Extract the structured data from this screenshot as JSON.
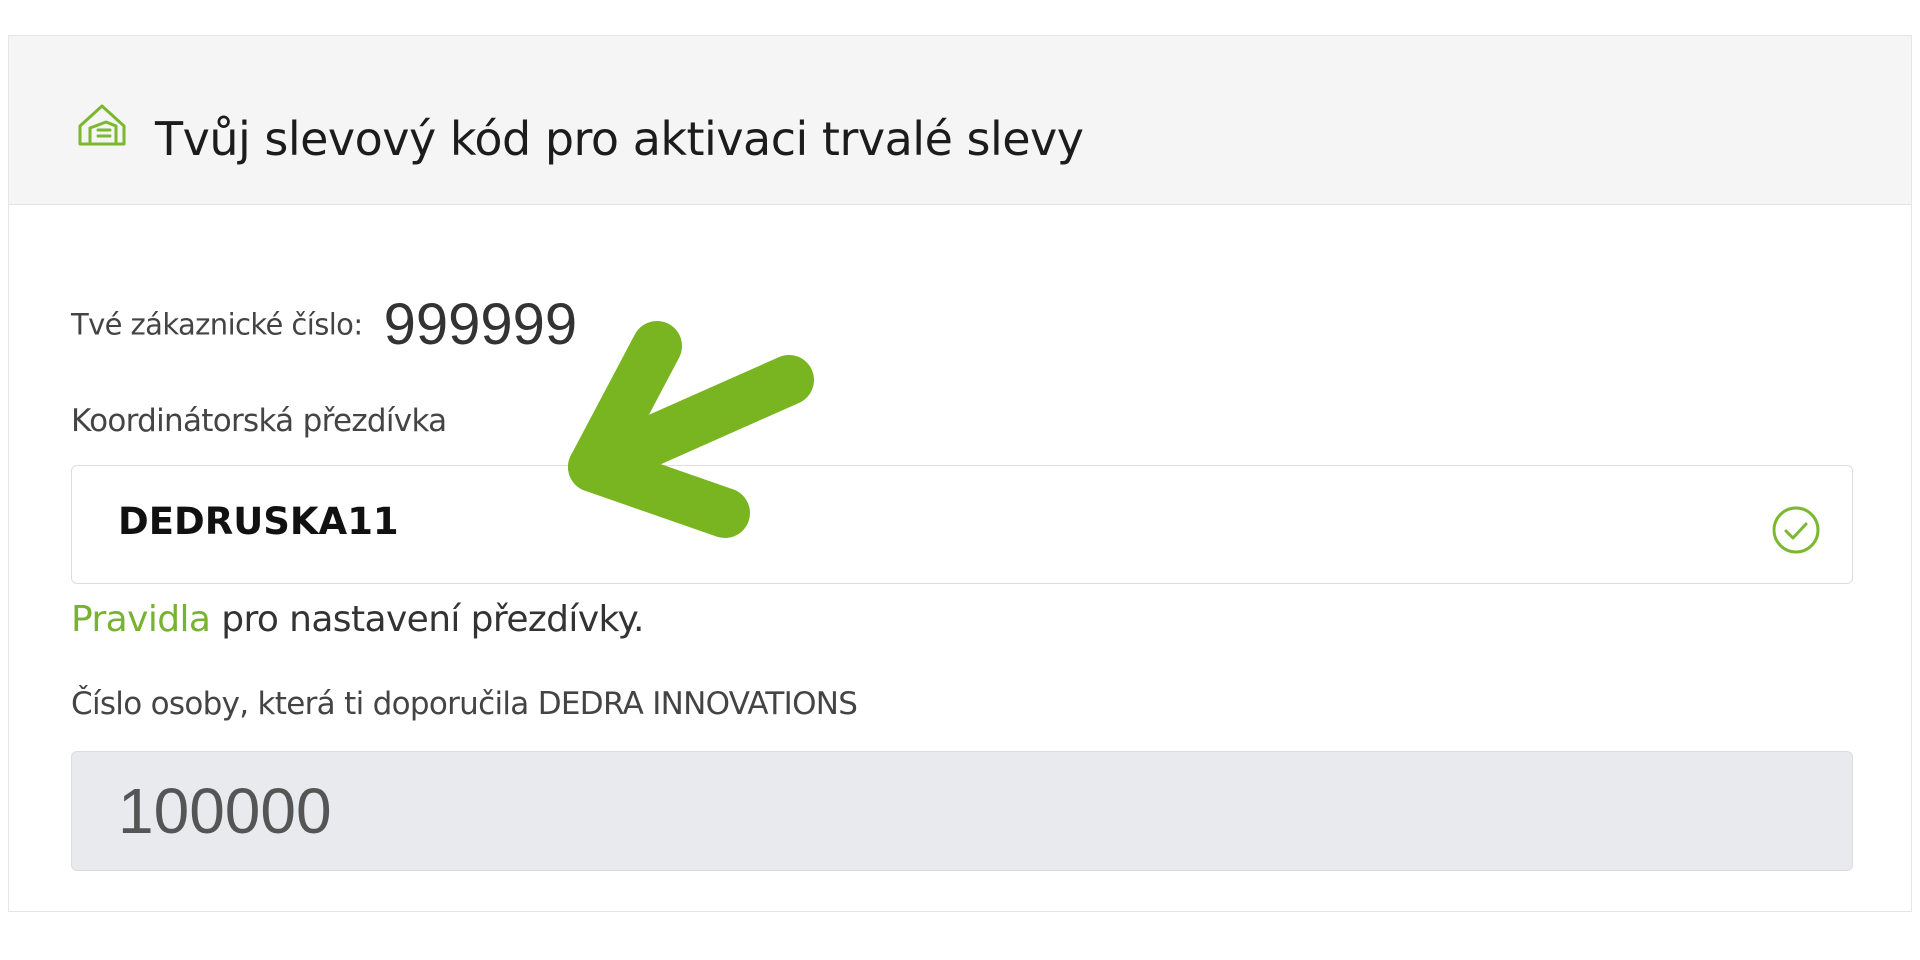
{
  "header": {
    "title": "Tvůj slevový kód pro aktivaci trvalé slevy",
    "icon": "house-hand-icon"
  },
  "customer": {
    "label": "Tvé zákaznické číslo:",
    "number": "999999"
  },
  "nickname": {
    "label": "Koordinátorská přezdívka",
    "value": "DEDRUSKA11",
    "status_icon": "check-circle-icon",
    "rules_link": "Pravidla",
    "rules_text": " pro nastavení přezdívky."
  },
  "referrer": {
    "label": "Číslo osoby, která ti doporučila DEDRA INNOVATIONS",
    "value": "100000"
  },
  "colors": {
    "accent_green": "#78b32f",
    "arrow_green": "#79b521",
    "header_bg": "#f5f5f5",
    "disabled_input_bg": "#e9eaee"
  }
}
